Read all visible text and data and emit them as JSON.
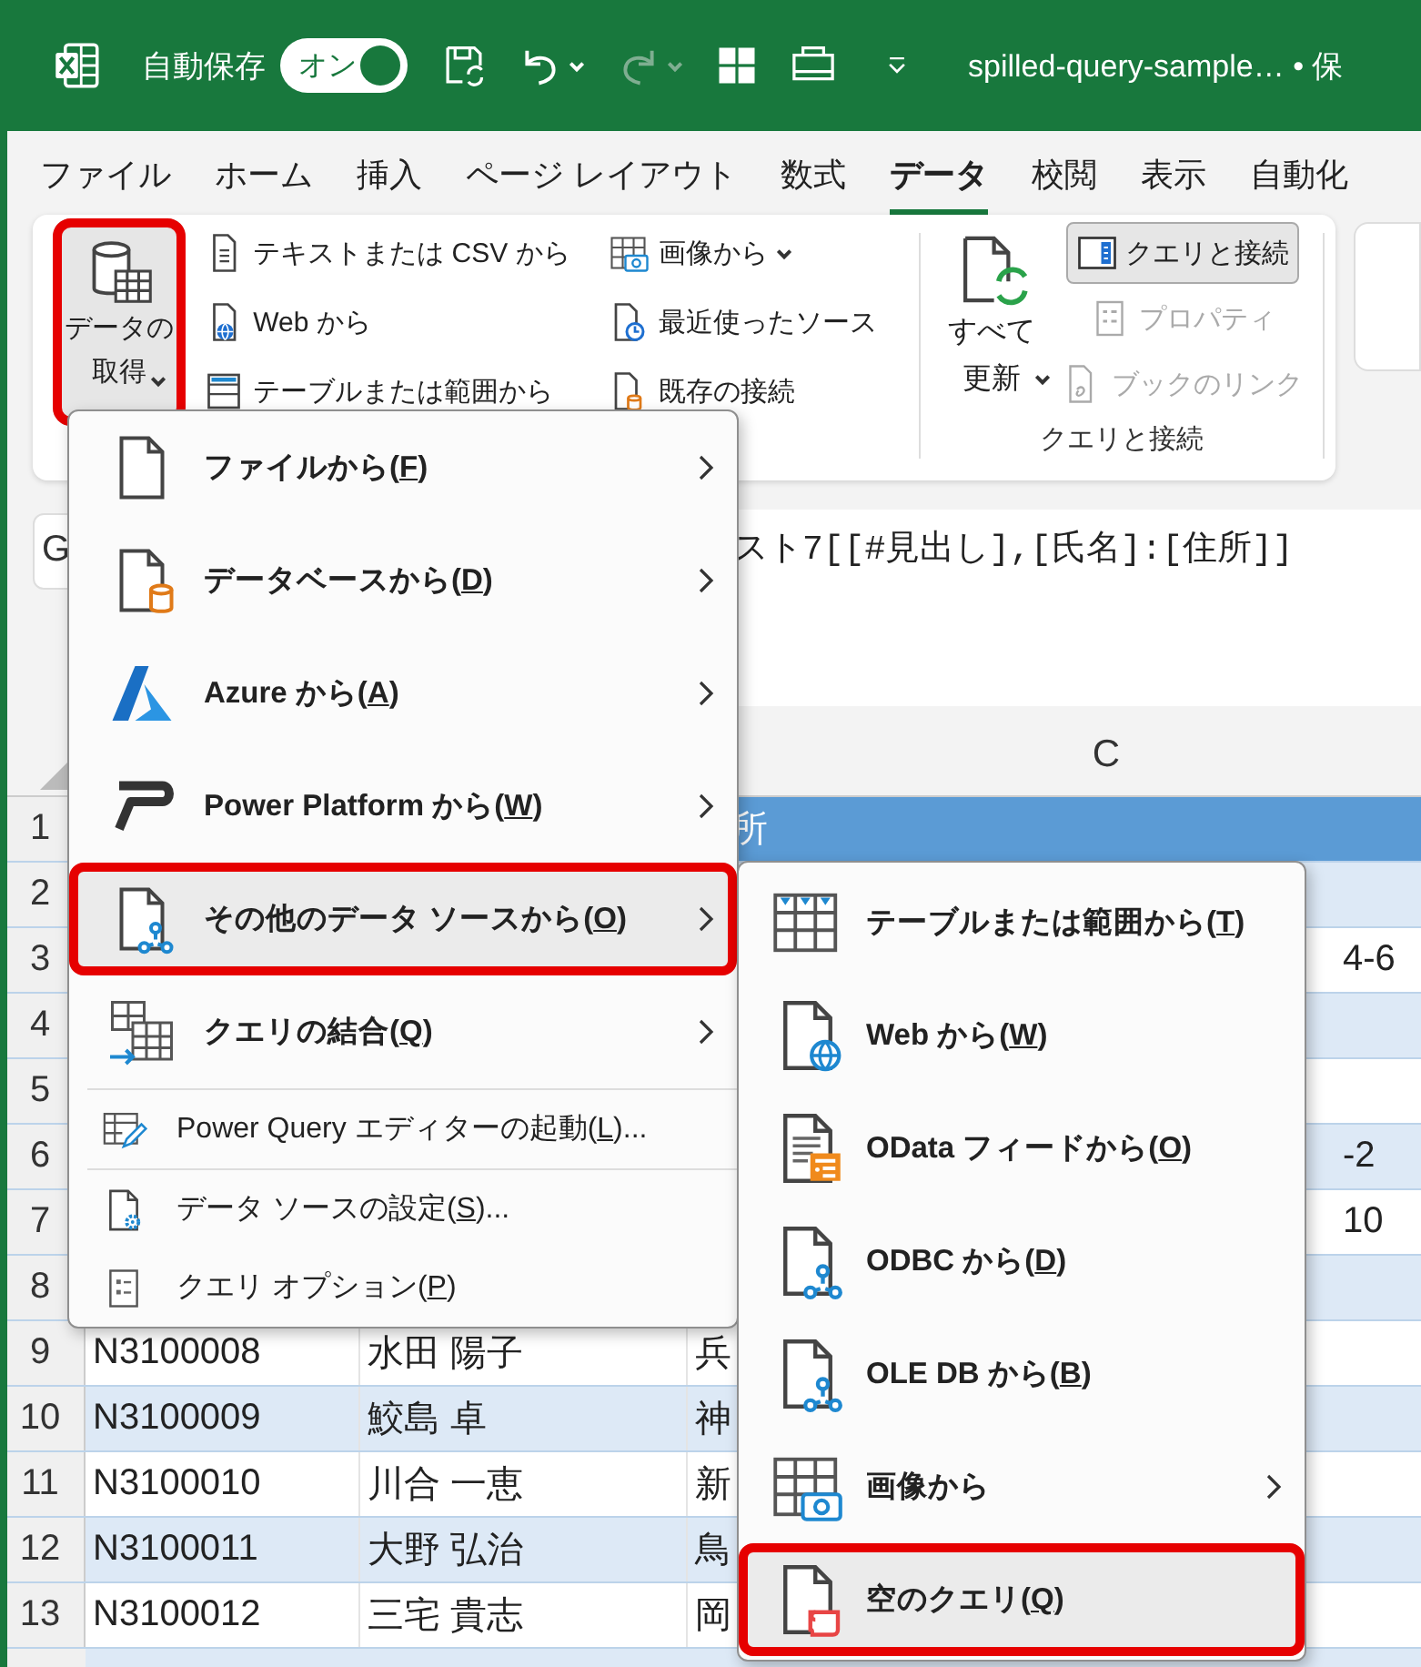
{
  "title_bar": {
    "autosave_label": "自動保存",
    "autosave_toggle": {
      "label": "オン",
      "on": true
    },
    "quick_access": [
      {
        "kind": "save",
        "disabled": false
      },
      {
        "kind": "undo",
        "disabled": false
      },
      {
        "kind": "redo",
        "disabled": true
      },
      {
        "kind": "layout",
        "disabled": false
      },
      {
        "kind": "print",
        "disabled": false
      },
      {
        "kind": "customize",
        "disabled": false
      }
    ],
    "document_title": "spilled-query-sample… • 保"
  },
  "tabs": [
    {
      "label": "ファイル",
      "selected": false
    },
    {
      "label": "ホーム",
      "selected": false
    },
    {
      "label": "挿入",
      "selected": false
    },
    {
      "label": "ページ レイアウト",
      "selected": false
    },
    {
      "label": "数式",
      "selected": false
    },
    {
      "label": "データ",
      "selected": true
    },
    {
      "label": "校閲",
      "selected": false
    },
    {
      "label": "表示",
      "selected": false
    },
    {
      "label": "自動化",
      "selected": false
    }
  ],
  "ribbon": {
    "get_data": {
      "label_lines": [
        "データの",
        "取得"
      ],
      "pressed": true,
      "highlighted": true
    },
    "import_buttons": [
      {
        "label": "テキストまたは CSV から",
        "dropdown": false
      },
      {
        "label": "Web から",
        "dropdown": false
      },
      {
        "label": "テーブルまたは範囲から",
        "dropdown": false
      },
      {
        "label": "画像から",
        "dropdown": true
      },
      {
        "label": "最近使ったソース",
        "dropdown": false
      },
      {
        "label": "既存の接続",
        "dropdown": false
      }
    ],
    "refresh_all": {
      "label_lines": [
        "すべて",
        "更新"
      ]
    },
    "query_buttons": [
      {
        "label": "クエリと接続",
        "pressed": true,
        "disabled": false
      },
      {
        "label": "プロパティ",
        "pressed": false,
        "disabled": true
      },
      {
        "label": "ブックのリンク",
        "pressed": false,
        "disabled": true
      }
    ],
    "group_label": "クエリと接続"
  },
  "formula_bar": {
    "name_box": "G",
    "formula": "スト7[[#見出し],[氏名]:[住所]]"
  },
  "sheet": {
    "columns": [
      "C"
    ],
    "rows": [
      {
        "number": "1",
        "kind": "header",
        "c": "所"
      },
      {
        "number": "2",
        "kind": "data"
      },
      {
        "number": "3",
        "kind": "data",
        "c": "4-6"
      },
      {
        "number": "4",
        "kind": "data"
      },
      {
        "number": "5",
        "kind": "data"
      },
      {
        "number": "6",
        "kind": "data",
        "c": "-2"
      },
      {
        "number": "7",
        "kind": "data",
        "c": "10"
      },
      {
        "number": "8",
        "kind": "data"
      },
      {
        "number": "9",
        "kind": "data",
        "a": "N3100008",
        "b": "水田 陽子",
        "c": "兵"
      },
      {
        "number": "10",
        "kind": "data",
        "a": "N3100009",
        "b": "鮫島 卓",
        "c": "神"
      },
      {
        "number": "11",
        "kind": "data",
        "a": "N3100010",
        "b": "川合 一恵",
        "c": "新"
      },
      {
        "number": "12",
        "kind": "data",
        "a": "N3100011",
        "b": "大野 弘治",
        "c": "鳥"
      },
      {
        "number": "13",
        "kind": "data",
        "a": "N3100012",
        "b": "三宅 貴志",
        "c": "岡"
      }
    ]
  },
  "data_menu": {
    "items": [
      {
        "kind": "large",
        "label": "ファイルから(",
        "access_key": "F",
        "label_end": ")",
        "submenu": true,
        "hovered": false,
        "highlighted": false
      },
      {
        "kind": "large",
        "label": "データベースから(",
        "access_key": "D",
        "label_end": ")",
        "submenu": true,
        "hovered": false,
        "highlighted": false
      },
      {
        "kind": "large",
        "label": "Azure から(",
        "access_key": "A",
        "label_end": ")",
        "submenu": true,
        "hovered": false,
        "highlighted": false
      },
      {
        "kind": "large",
        "label": "Power Platform から(",
        "access_key": "W",
        "label_end": ")",
        "submenu": true,
        "hovered": false,
        "highlighted": false
      },
      {
        "kind": "large",
        "label": "その他のデータ ソースから(",
        "access_key": "O",
        "label_end": ")",
        "submenu": true,
        "hovered": true,
        "highlighted": true
      },
      {
        "kind": "large",
        "label": "クエリの結合(",
        "access_key": "Q",
        "label_end": ")",
        "submenu": true,
        "hovered": false,
        "highlighted": false
      },
      {
        "kind": "separator"
      },
      {
        "kind": "small",
        "label": "Power Query エディターの起動(",
        "access_key": "L",
        "label_end": ")...",
        "submenu": false,
        "hovered": false,
        "highlighted": false
      },
      {
        "kind": "separator"
      },
      {
        "kind": "small",
        "label": "データ ソースの設定(",
        "access_key": "S",
        "label_end": ")...",
        "submenu": false,
        "hovered": false,
        "highlighted": false
      },
      {
        "kind": "small",
        "label": "クエリ オプション(",
        "access_key": "P",
        "label_end": ")",
        "submenu": false,
        "hovered": false,
        "highlighted": false
      }
    ]
  },
  "sub_menu": {
    "items": [
      {
        "label": "テーブルまたは範囲から(",
        "access_key": "T",
        "label_end": ")",
        "submenu": false,
        "hovered": false,
        "highlighted": false
      },
      {
        "label": "Web から(",
        "access_key": "W",
        "label_end": ")",
        "submenu": false,
        "hovered": false,
        "highlighted": false
      },
      {
        "label": "OData フィードから(",
        "access_key": "O",
        "label_end": ")",
        "submenu": false,
        "hovered": false,
        "highlighted": false
      },
      {
        "label": "ODBC から(",
        "access_key": "D",
        "label_end": ")",
        "submenu": false,
        "hovered": false,
        "highlighted": false
      },
      {
        "label": "OLE DB から(",
        "access_key": "B",
        "label_end": ")",
        "submenu": false,
        "hovered": false,
        "highlighted": false
      },
      {
        "label": "画像から",
        "submenu": true,
        "hovered": false,
        "highlighted": false
      },
      {
        "label": "空のクエリ(",
        "access_key": "Q",
        "label_end": ")",
        "submenu": false,
        "hovered": true,
        "highlighted": true
      }
    ]
  }
}
